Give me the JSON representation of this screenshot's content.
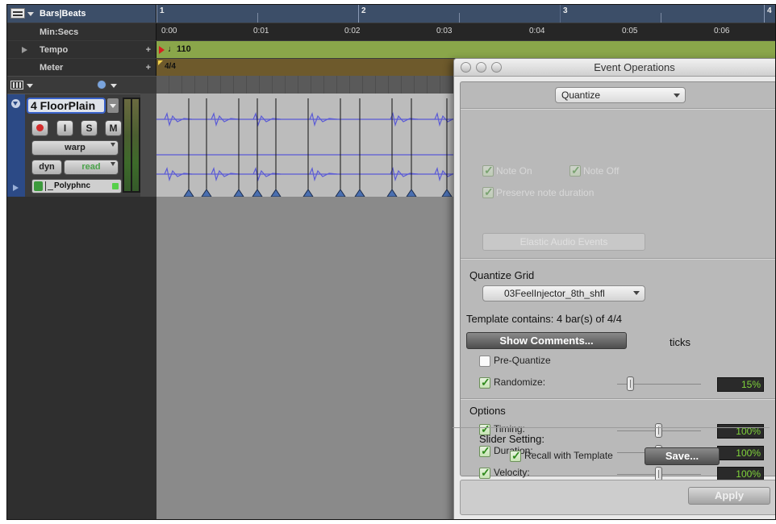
{
  "rulers": {
    "bars_label": "Bars|Beats",
    "bar_ticks": [
      "1",
      "2",
      "3",
      "4"
    ],
    "min_label": "Min:Secs",
    "min_ticks": [
      "0:00",
      "0:01",
      "0:02",
      "0:03",
      "0:04",
      "0:05",
      "0:06"
    ],
    "tempo_label": "Tempo",
    "tempo_value": "110",
    "meter_label": "Meter",
    "meter_value": "4/4"
  },
  "track": {
    "name": "4 FloorPlain",
    "record_label": "",
    "input_label": "I",
    "solo_label": "S",
    "mute_label": "M",
    "mode": "warp",
    "dyn_label": "dyn",
    "automation": "read",
    "voice": "Polyphnc"
  },
  "dialog": {
    "title": "Event Operations",
    "operation": "Quantize",
    "note_on": "Note On",
    "note_off": "Note Off",
    "preserve": "Preserve note duration",
    "elastic": "Elastic Audio Events",
    "grid_heading": "Quantize Grid",
    "grid_value": "03FeelInjector_8th_shfl",
    "template_text": "Template contains: 4 bar(s) of 4/4",
    "show_comments": "Show Comments...",
    "ticks": "ticks",
    "pre_quantize": "Pre-Quantize",
    "randomize": "Randomize:",
    "randomize_value": "15%",
    "randomize_level": 0.15,
    "options_heading": "Options",
    "timing": "Timing:",
    "timing_value": "100%",
    "duration": "Duration:",
    "duration_value": "100%",
    "velocity": "Velocity:",
    "velocity_value": "100%",
    "slider_setting": "Slider Setting:",
    "recall": "Recall with Template",
    "save": "Save...",
    "apply": "Apply"
  },
  "colors": {
    "tempo_ruler": "#8aa64a",
    "meter_ruler": "#6e5a2c",
    "waveform": "#5a5ad6",
    "value_green": "#7fd33a"
  }
}
